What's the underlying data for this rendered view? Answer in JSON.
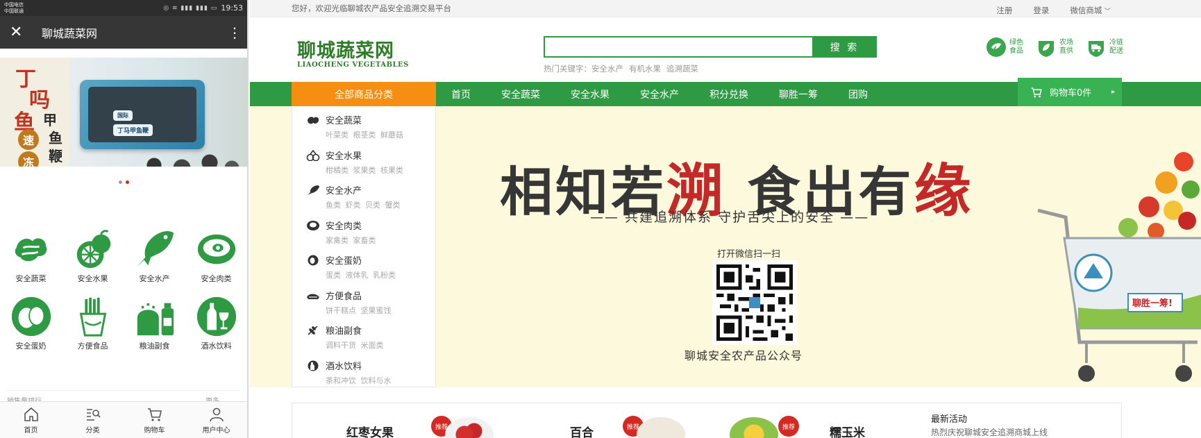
{
  "phone": {
    "status": {
      "carrier1": "中国电信",
      "carrier2": "中国联通",
      "time": "19:53"
    },
    "app_bar": {
      "title": "聊城蔬菜网"
    },
    "banner": {
      "chars_red": [
        "丁",
        "吗",
        "鱼"
      ],
      "chars_dark": [
        "甲",
        "鱼",
        "鞭"
      ],
      "seals": [
        "速",
        "冻"
      ],
      "pack_label": "丁马甲鱼鞭",
      "brand_mark": "国际",
      "dot_count": 2,
      "active_dot": 1
    },
    "categories": [
      {
        "label": "安全蔬菜",
        "icon": "vegetable-icon"
      },
      {
        "label": "安全水果",
        "icon": "fruit-icon"
      },
      {
        "label": "安全水产",
        "icon": "fish-icon"
      },
      {
        "label": "安全肉类",
        "icon": "meat-icon"
      },
      {
        "label": "安全蛋奶",
        "icon": "egg-icon"
      },
      {
        "label": "方便食品",
        "icon": "fries-icon"
      },
      {
        "label": "粮油副食",
        "icon": "grain-oil-icon"
      },
      {
        "label": "酒水饮料",
        "icon": "wine-icon"
      }
    ],
    "peek": {
      "left": "销售量排行",
      "right": "更多"
    },
    "tabs": [
      {
        "label": "首页",
        "icon": "home-icon"
      },
      {
        "label": "分类",
        "icon": "category-search-icon"
      },
      {
        "label": "购物车",
        "icon": "cart-icon"
      },
      {
        "label": "用户中心",
        "icon": "user-icon"
      }
    ]
  },
  "site": {
    "topbar": {
      "welcome": "您好，欢迎光临聊城农产品安全追溯交易平台",
      "register": "注册",
      "login": "登录",
      "wechat_mall": "微信商城"
    },
    "logo": {
      "cn": "聊城蔬菜网",
      "en": "LIAOCHENG VEGETABLES"
    },
    "search": {
      "value": "",
      "button": "搜 索",
      "hot_label": "热门关键字：",
      "hot_keywords": [
        "安全水产",
        "有机水果",
        "追溯蔬菜"
      ]
    },
    "badges": [
      {
        "line1": "绿色",
        "line2": "食品",
        "icon": "green-food-icon"
      },
      {
        "line1": "农场",
        "line2": "直供",
        "icon": "farm-direct-icon"
      },
      {
        "line1": "冷链",
        "line2": "配送",
        "icon": "cold-chain-truck-icon"
      }
    ],
    "nav": {
      "all_categories": "全部商品分类",
      "items": [
        "首页",
        "安全蔬菜",
        "安全水果",
        "安全水产",
        "积分兑换",
        "聊胜一筹",
        "团购"
      ],
      "cart": "购物车0件"
    },
    "category_menu": [
      {
        "title": "安全蔬菜",
        "sub": "叶菜类 根茎类 鲜蘑菇",
        "icon": "vegetable-icon"
      },
      {
        "title": "安全水果",
        "sub": "柑橘类 浆果类 核果类",
        "icon": "fruit-icon"
      },
      {
        "title": "安全水产",
        "sub": "鱼类 虾类 贝类 蟹类",
        "icon": "fish-icon"
      },
      {
        "title": "安全肉类",
        "sub": "家禽类 家畜类",
        "icon": "meat-icon"
      },
      {
        "title": "安全蛋奶",
        "sub": "蛋类 液体乳 乳粉类",
        "icon": "egg-icon"
      },
      {
        "title": "方便食品",
        "sub": "饼干糕点 坚果蜜饯",
        "icon": "snack-icon"
      },
      {
        "title": "粮油副食",
        "sub": "调料干货 米面类",
        "icon": "grain-icon"
      },
      {
        "title": "酒水饮料",
        "sub": "茶和冲饮 饮料与水",
        "icon": "drink-icon"
      }
    ],
    "banner": {
      "headline_a": "相知若",
      "headline_b": "溯",
      "headline_c": " 食出有",
      "headline_d": "缘",
      "subline": "—— 共建追溯体系  守护舌尖上的安全 ——",
      "qr_label": "打开微信扫一扫",
      "qr_caption": "聊城安全农产品公众号",
      "cart_sign": "聊胜一筹!"
    },
    "promo": {
      "products": [
        "红枣女果",
        "百合",
        "糯玉米"
      ],
      "tag": "推荐",
      "news_title": "最新活动",
      "news_item": "热烈庆祝聊城安全追溯商城上线"
    }
  }
}
